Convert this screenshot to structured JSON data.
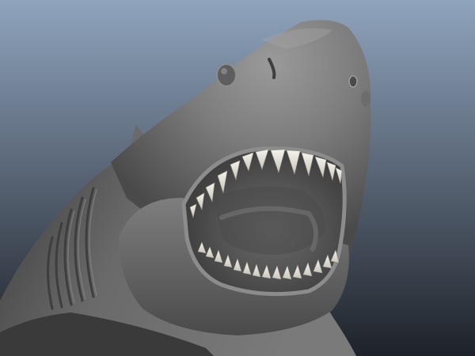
{
  "scene": {
    "subject": "shark-3d-model",
    "render_style": "untextured grey clay viewport render",
    "colors": {
      "background_top": "#8ea3bb",
      "background_bottom": "#20252c",
      "body_light": "#8a8a8a",
      "body_mid": "#6e6e6e",
      "body_dark": "#3e3e3e",
      "mouth_interior": "#565656",
      "teeth": "#e9e6de"
    }
  }
}
